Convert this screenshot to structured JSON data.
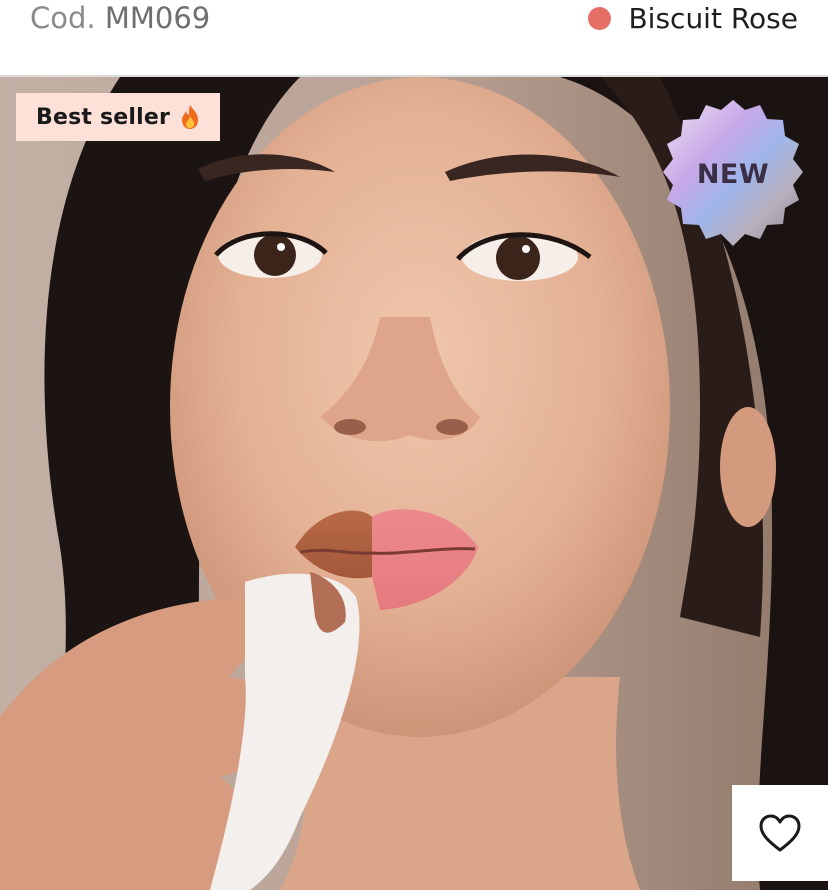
{
  "header": {
    "code_prefix": "Cod.",
    "code_value": "MM069",
    "shade_name": "Biscuit Rose",
    "shade_color": "#e56f64"
  },
  "badges": {
    "best_seller_label": "Best seller",
    "best_seller_icon": "fire-icon",
    "new_label": "NEW"
  },
  "product_image": {
    "subject": "product-photo-model"
  },
  "wishlist": {
    "icon": "heart-outline-icon"
  },
  "colors": {
    "best_seller_bg": "#fde0d8",
    "divider": "#dcdcdc",
    "text_muted": "#8a8a8a"
  }
}
